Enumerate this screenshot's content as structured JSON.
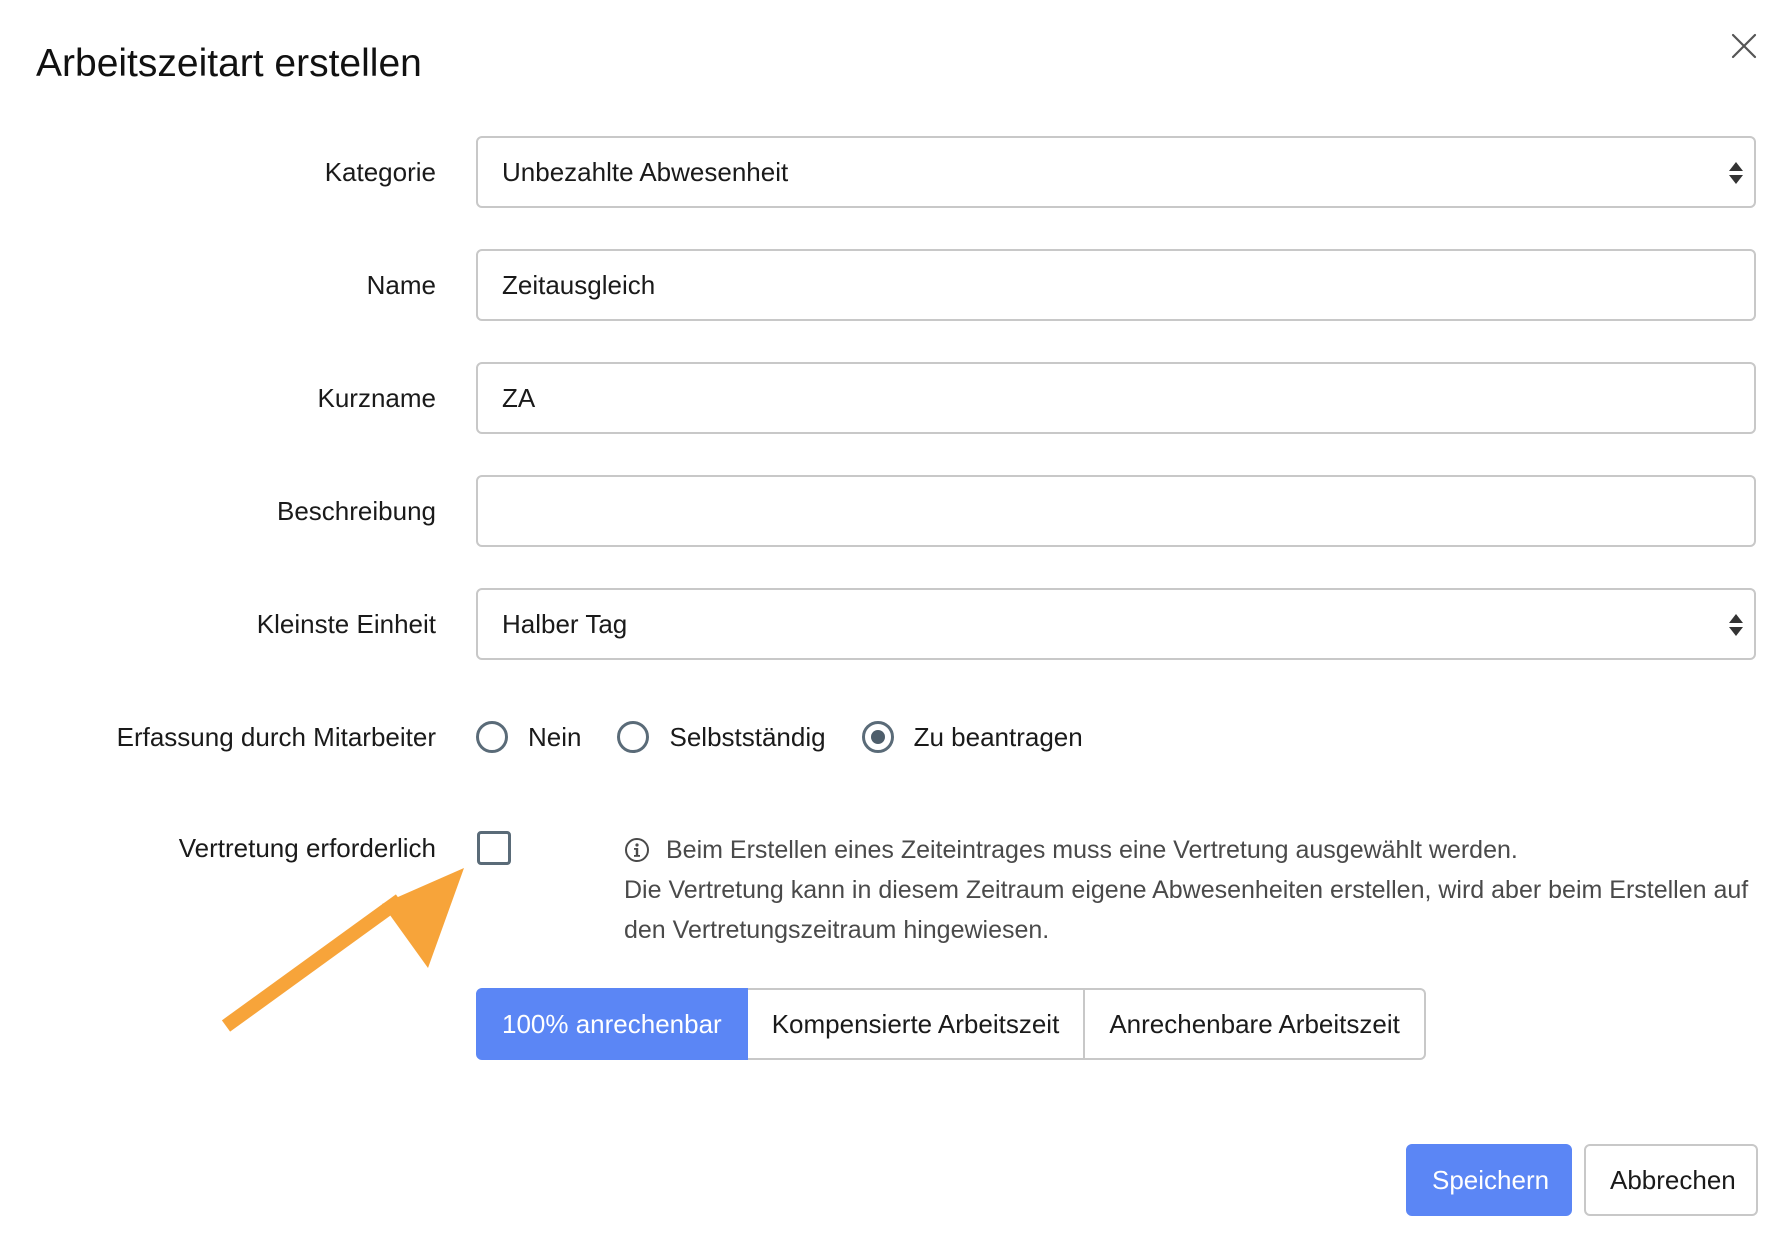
{
  "dialog": {
    "title": "Arbeitszeitart erstellen",
    "close_icon": "close-icon"
  },
  "form": {
    "kategorie": {
      "label": "Kategorie",
      "value": "Unbezahlte Abwesenheit"
    },
    "name": {
      "label": "Name",
      "value": "Zeitausgleich"
    },
    "kurzname": {
      "label": "Kurzname",
      "value": "ZA"
    },
    "beschreibung": {
      "label": "Beschreibung",
      "value": ""
    },
    "kleinste_einheit": {
      "label": "Kleinste Einheit",
      "value": "Halber Tag"
    },
    "erfassung": {
      "label": "Erfassung durch Mitarbeiter",
      "options": [
        {
          "label": "Nein",
          "checked": false
        },
        {
          "label": "Selbstständig",
          "checked": false
        },
        {
          "label": "Zu beantragen",
          "checked": true
        }
      ]
    },
    "vertretung": {
      "label": "Vertretung erforderlich",
      "checked": false,
      "info_line1": "Beim Erstellen eines Zeiteintrages muss eine Vertretung ausgewählt werden.",
      "info_line2": "Die Vertretung kann in diesem Zeitraum eigene Abwesenheiten erstellen, wird aber beim Erstellen auf den Vertretungszeitraum hingewiesen."
    },
    "anrechnung": {
      "options": [
        {
          "label": "100% anrechenbar",
          "active": true
        },
        {
          "label": "Kompensierte Arbeitszeit",
          "active": false
        },
        {
          "label": "Anrechenbare Arbeitszeit",
          "active": false
        }
      ]
    }
  },
  "footer": {
    "save_label": "Speichern",
    "cancel_label": "Abbrechen"
  },
  "colors": {
    "primary": "#5b86f5",
    "annotation_arrow": "#f7a43a",
    "control_border": "#5a6b78"
  }
}
